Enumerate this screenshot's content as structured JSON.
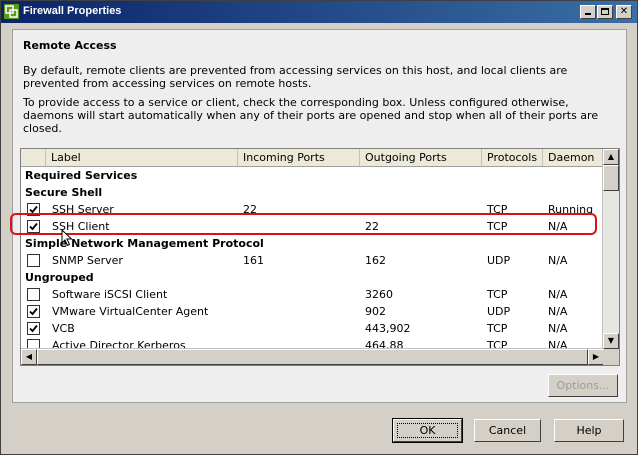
{
  "window": {
    "title": "Firewall Properties"
  },
  "panel": {
    "heading": "Remote Access",
    "desc1": "By default, remote clients are prevented from accessing services on this host, and local clients are prevented from accessing services on remote hosts.",
    "desc2": "To provide access to a service or client, check the corresponding box. Unless configured otherwise, daemons will start automatically when any of their ports are opened and stop when all of their ports are closed."
  },
  "table": {
    "columns": [
      "Label",
      "Incoming Ports",
      "Outgoing Ports",
      "Protocols",
      "Daemon"
    ],
    "rows": [
      {
        "type": "group",
        "label": "Required Services"
      },
      {
        "type": "group",
        "label": "Secure Shell"
      },
      {
        "type": "item",
        "checked": true,
        "label": "SSH Server",
        "incoming": "22",
        "outgoing": "",
        "protocols": "TCP",
        "daemon": "Running"
      },
      {
        "type": "item",
        "checked": true,
        "label": "SSH Client",
        "incoming": "",
        "outgoing": "22",
        "protocols": "TCP",
        "daemon": "N/A"
      },
      {
        "type": "group",
        "label": "Simple Network Management Protocol"
      },
      {
        "type": "item",
        "checked": false,
        "label": "SNMP Server",
        "incoming": "161",
        "outgoing": "162",
        "protocols": "UDP",
        "daemon": "N/A"
      },
      {
        "type": "group",
        "label": "Ungrouped"
      },
      {
        "type": "item",
        "checked": false,
        "label": "Software iSCSI Client",
        "incoming": "",
        "outgoing": "3260",
        "protocols": "TCP",
        "daemon": "N/A"
      },
      {
        "type": "item",
        "checked": true,
        "label": "VMware VirtualCenter Agent",
        "incoming": "",
        "outgoing": "902",
        "protocols": "UDP",
        "daemon": "N/A"
      },
      {
        "type": "item",
        "checked": true,
        "label": "VCB",
        "incoming": "",
        "outgoing": "443,902",
        "protocols": "TCP",
        "daemon": "N/A"
      },
      {
        "type": "item",
        "checked": false,
        "label": "Active Director Kerberos",
        "incoming": "",
        "outgoing": "464,88",
        "protocols": "TCP",
        "daemon": "N/A"
      }
    ]
  },
  "buttons": {
    "options": "Options...",
    "ok": "OK",
    "cancel": "Cancel",
    "help": "Help"
  },
  "colors": {
    "titlebar": "#0a246a",
    "highlight": "#dd1111",
    "panel": "#eeeeee"
  },
  "icons": {
    "app": "vmware-logo-icon",
    "minimize": "minimize-icon",
    "maximize": "maximize-icon",
    "close": "close-icon",
    "cursor": "mouse-cursor-icon"
  }
}
